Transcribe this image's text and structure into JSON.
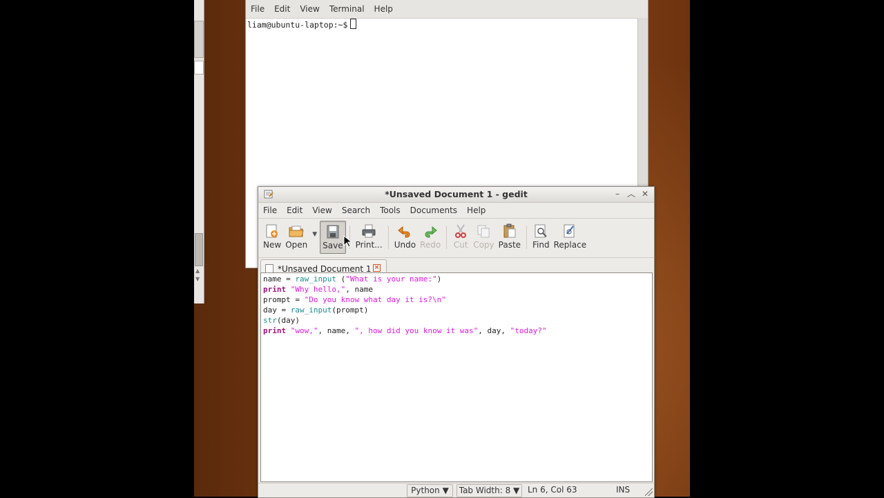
{
  "terminal": {
    "menus": [
      "File",
      "Edit",
      "View",
      "Terminal",
      "Help"
    ],
    "prompt": "liam@ubuntu-laptop:~$"
  },
  "gedit": {
    "title": "*Unsaved Document 1 - gedit",
    "menus": [
      "File",
      "Edit",
      "View",
      "Search",
      "Tools",
      "Documents",
      "Help"
    ],
    "toolbar": {
      "new": "New",
      "open": "Open",
      "save": "Save",
      "print": "Print...",
      "undo": "Undo",
      "redo": "Redo",
      "cut": "Cut",
      "copy": "Copy",
      "paste": "Paste",
      "find": "Find",
      "replace": "Replace"
    },
    "tab_label": "*Unsaved Document 1",
    "code": [
      [
        {
          "t": "name = ",
          "c": "plain"
        },
        {
          "t": "raw_input",
          "c": "fn"
        },
        {
          "t": " (",
          "c": "plain"
        },
        {
          "t": "\"What is your name:\"",
          "c": "str"
        },
        {
          "t": ")",
          "c": "plain"
        }
      ],
      [
        {
          "t": "print",
          "c": "kw"
        },
        {
          "t": " ",
          "c": "plain"
        },
        {
          "t": "\"Why hello,\"",
          "c": "str"
        },
        {
          "t": ", name",
          "c": "plain"
        }
      ],
      [
        {
          "t": "prompt = ",
          "c": "plain"
        },
        {
          "t": "\"Do you know what day it is?\\n\"",
          "c": "str"
        }
      ],
      [
        {
          "t": "day = ",
          "c": "plain"
        },
        {
          "t": "raw_input",
          "c": "fn"
        },
        {
          "t": "(prompt)",
          "c": "plain"
        }
      ],
      [
        {
          "t": "str",
          "c": "fn"
        },
        {
          "t": "(day)",
          "c": "plain"
        }
      ],
      [
        {
          "t": "print",
          "c": "kw"
        },
        {
          "t": " ",
          "c": "plain"
        },
        {
          "t": "\"wow,\"",
          "c": "str"
        },
        {
          "t": ", name, ",
          "c": "plain"
        },
        {
          "t": "\", how did you know it was\"",
          "c": "str"
        },
        {
          "t": ", day, ",
          "c": "plain"
        },
        {
          "t": "\"today?\"",
          "c": "str"
        }
      ]
    ],
    "status": {
      "language": "Python",
      "tab_width": "Tab Width: 8",
      "position": "Ln 6, Col 63",
      "mode": "INS"
    }
  }
}
